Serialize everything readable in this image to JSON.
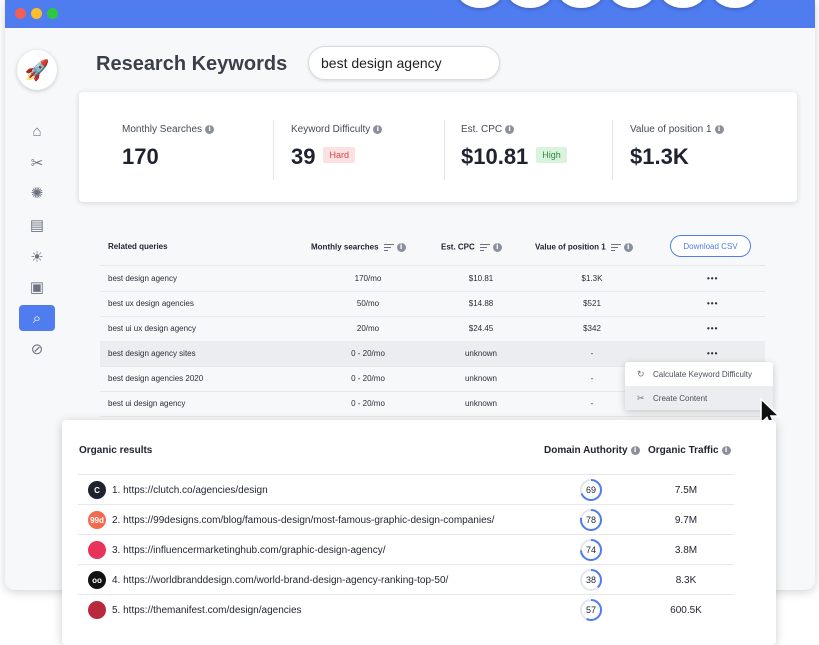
{
  "colors": {
    "accent": "#4f7cef",
    "hard": "#d14848",
    "high": "#2e8b3e"
  },
  "sidebar": {
    "logo_icon": "rocket-icon",
    "items": [
      {
        "icon": "home-icon",
        "glyph": "⌂",
        "active": false
      },
      {
        "icon": "tools-icon",
        "glyph": "✂",
        "active": false
      },
      {
        "icon": "atom-icon",
        "glyph": "✺",
        "active": false
      },
      {
        "icon": "seo-document-icon",
        "glyph": "▤",
        "active": false
      },
      {
        "icon": "lightbulb-icon",
        "glyph": "☀",
        "active": false
      },
      {
        "icon": "browser-window-icon",
        "glyph": "▣",
        "active": false
      },
      {
        "icon": "keyword-research-icon",
        "glyph": "⌕",
        "active": true
      },
      {
        "icon": "search-analytics-icon",
        "glyph": "⊘",
        "active": false
      }
    ]
  },
  "header": {
    "title": "Research Keywords",
    "search_value": "best design agency"
  },
  "metrics": [
    {
      "label": "Monthly Searches",
      "value": "170",
      "badge": ""
    },
    {
      "label": "Keyword Difficulty",
      "value": "39",
      "badge": "Hard"
    },
    {
      "label": "Est. CPC",
      "value": "$10.81",
      "badge": "High"
    },
    {
      "label": "Value of position 1",
      "value": "$1.3K",
      "badge": ""
    }
  ],
  "queries": {
    "headers": {
      "query": "Related queries",
      "searches": "Monthly searches",
      "cpc": "Est. CPC",
      "value": "Value of position 1"
    },
    "download_label": "Download CSV",
    "rows": [
      {
        "query": "best design agency",
        "searches": "170/mo",
        "cpc": "$10.81",
        "value": "$1.3K",
        "menu": "•••"
      },
      {
        "query": "best ux design agencies",
        "searches": "50/mo",
        "cpc": "$14.88",
        "value": "$521",
        "menu": "•••"
      },
      {
        "query": "best ui ux design agency",
        "searches": "20/mo",
        "cpc": "$24.45",
        "value": "$342",
        "menu": "•••"
      },
      {
        "query": "best design agency sites",
        "searches": "0 - 20/mo",
        "cpc": "unknown",
        "value": "-",
        "menu": "•••"
      },
      {
        "query": "best design agencies 2020",
        "searches": "0 - 20/mo",
        "cpc": "unknown",
        "value": "-",
        "menu": ""
      },
      {
        "query": "best ui design agency",
        "searches": "0 - 20/mo",
        "cpc": "unknown",
        "value": "-",
        "menu": ""
      }
    ]
  },
  "context_menu": [
    {
      "icon": "refresh-icon",
      "label": "Calculate Keyword Difficulty"
    },
    {
      "icon": "content-icon",
      "label": "Create Content"
    }
  ],
  "organic": {
    "title": "Organic results",
    "col_authority": "Domain Authority",
    "col_traffic": "Organic Traffic",
    "rows": [
      {
        "url": "1. https://clutch.co/agencies/design",
        "authority": 69,
        "traffic": "7.5M",
        "fav_text": "C",
        "fav_color": "#1f2330",
        "fav_icon": "clutch-logo-icon"
      },
      {
        "url": "2. https://99designs.com/blog/famous-design/most-famous-graphic-design-companies/",
        "authority": 78,
        "traffic": "9.7M",
        "fav_text": "99d",
        "fav_color": "#f26b4f",
        "fav_icon": "99designs-logo-icon"
      },
      {
        "url": "3. https://influencermarketinghub.com/graphic-design-agency/",
        "authority": 74,
        "traffic": "3.8M",
        "fav_text": "",
        "fav_color": "#e8335a",
        "fav_icon": "influencer-hub-logo-icon"
      },
      {
        "url": "4. https://worldbranddesign.com/world-brand-design-agency-ranking-top-50/",
        "authority": 38,
        "traffic": "8.3K",
        "fav_text": "oo",
        "fav_color": "#111111",
        "fav_icon": "worldbranddesign-logo-icon"
      },
      {
        "url": "5. https://themanifest.com/design/agencies",
        "authority": 57,
        "traffic": "600.5K",
        "fav_text": "",
        "fav_color": "#b8293e",
        "fav_icon": "themanifest-logo-icon"
      }
    ]
  }
}
